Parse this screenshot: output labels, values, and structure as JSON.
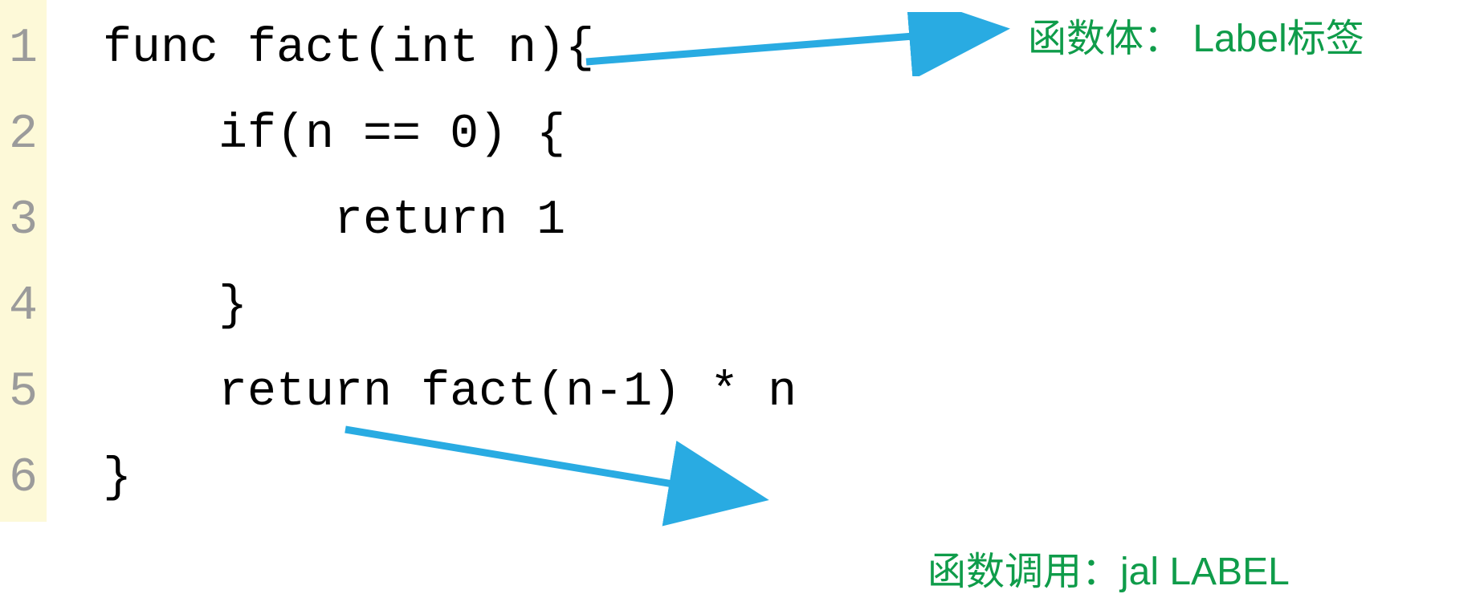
{
  "code": {
    "line_numbers": [
      "1",
      "2",
      "3",
      "4",
      "5",
      "6"
    ],
    "lines": [
      "func fact(int n){",
      "    if(n == 0) {",
      "        return 1",
      "    }",
      "    return fact(n-1) * n",
      "}"
    ]
  },
  "annotations": {
    "top": "函数体： Label标签",
    "bottom": "函数调用：jal LABEL"
  },
  "colors": {
    "arrow": "#29abe2",
    "annotation": "#0f9c4a",
    "gutter_bg": "#fdf9d8",
    "line_num": "#9b9b9b"
  }
}
